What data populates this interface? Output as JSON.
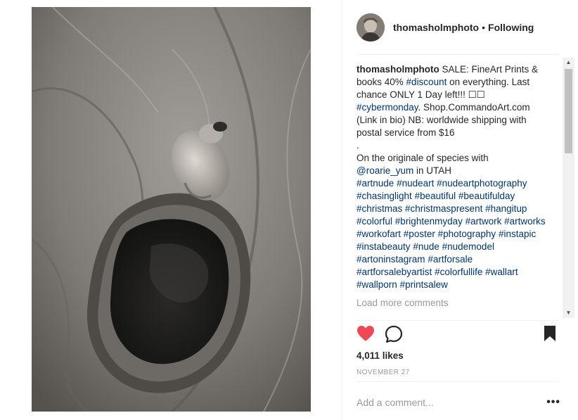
{
  "header": {
    "username": "thomasholmphoto",
    "separator": "•",
    "follow_status": "Following"
  },
  "caption": {
    "username": "thomasholmphoto",
    "text_1": " SALE: FineArt Prints & books 40% ",
    "tag_discount": "#discount",
    "text_2": " on everything. Last chance ONLY 1 Day left!!! ☐☐ ",
    "tag_cybermonday": "#cybermonday",
    "text_3": ". Shop.CommandoArt.com (Link in bio) NB: worldwide shipping with postal service from $16",
    "dot_line": ".",
    "text_4": "On the originale of species with ",
    "mention": "@roarie_yum",
    "text_5": " in UTAH",
    "hashtags": [
      "#artnude",
      "#nudeart",
      "#nudeartphotography",
      "#chasinglight",
      "#beautiful",
      "#beautifulday",
      "#christmas",
      "#christmaspresent",
      "#hangitup",
      "#colorful",
      "#brightenmyday",
      "#artwork",
      "#artworks",
      "#workofart",
      "#poster",
      "#photography",
      "#instapic",
      "#instabeauty",
      "#nude",
      "#nudemodel",
      "#artoninstagram",
      "#artforsale",
      "#artforsalebyartist",
      "#colorfullife",
      "#wallart",
      "#wallporn",
      "#printsalew"
    ]
  },
  "comments": {
    "load_more": "Load more comments",
    "partial_next": "..."
  },
  "actions": {
    "like_icon": "heart-icon-filled",
    "comment_icon": "comment-icon",
    "save_icon": "bookmark-icon",
    "like_color": "#ed4956"
  },
  "likes": "4,011 likes",
  "date": "NOVEMBER 27",
  "comment_form": {
    "placeholder": "Add a comment...",
    "more_label": "•••"
  }
}
